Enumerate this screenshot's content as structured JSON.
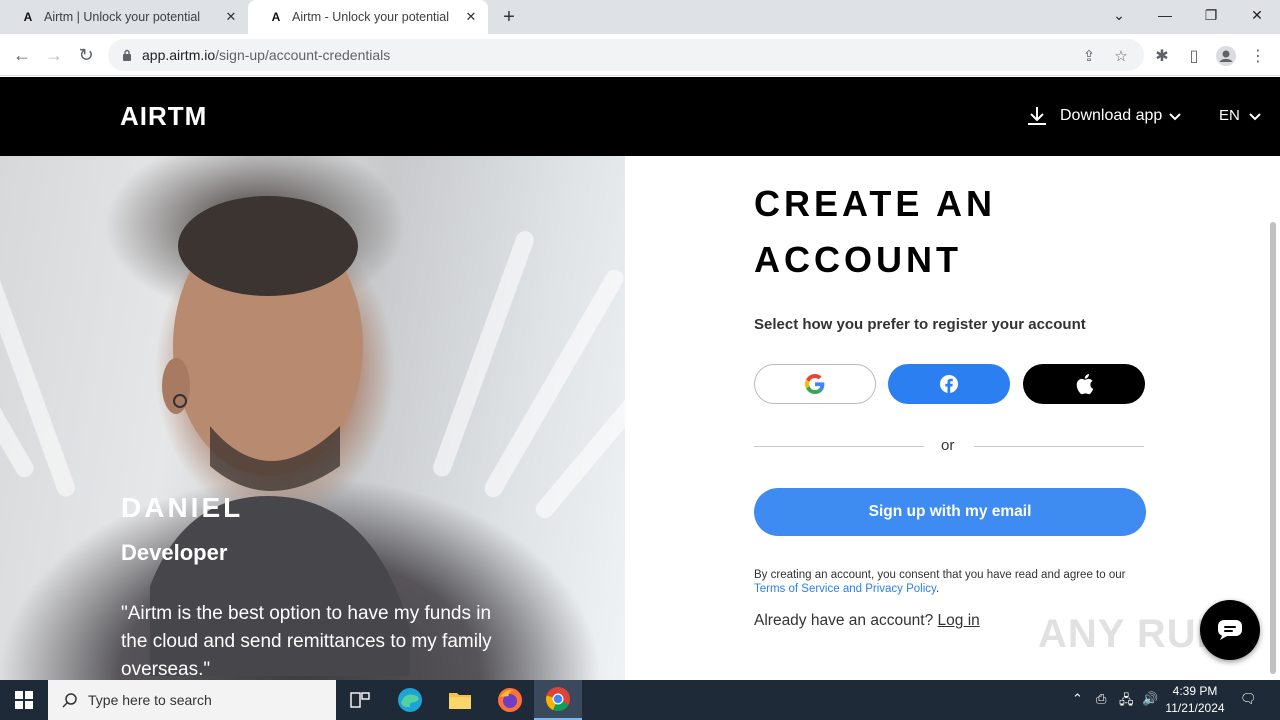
{
  "browser": {
    "tabs": [
      {
        "title": "Airtm | Unlock your potential",
        "active": false
      },
      {
        "title": "Airtm - Unlock your potential",
        "active": true
      }
    ],
    "url_domain": "app.airtm.io",
    "url_path": "/sign-up/account-credentials"
  },
  "header": {
    "logo": "AIRTM",
    "download_label": "Download app",
    "language": "EN"
  },
  "hero": {
    "name": "DANIEL",
    "role": "Developer",
    "quote": "\"Airtm is the best option to have my funds in the cloud and send remittances to my family overseas.\""
  },
  "form": {
    "title": "CREATE AN ACCOUNT",
    "subtitle": "Select how you prefer to register your account",
    "divider_text": "or",
    "email_button": "Sign up with my email",
    "consent_prefix": "By creating an account, you consent that you have read and agree to our",
    "consent_link": "Terms of Service and Privacy Policy",
    "consent_suffix": ".",
    "login_prompt": "Already have an account?",
    "login_link": "Log in"
  },
  "colors": {
    "facebook_blue": "#2b7ff0",
    "primary_blue": "#3e8bf2",
    "header_black": "#000000"
  },
  "watermark": "ANY RUN",
  "taskbar": {
    "search_placeholder": "Type here to search",
    "time": "4:39 PM",
    "date": "11/21/2024"
  }
}
